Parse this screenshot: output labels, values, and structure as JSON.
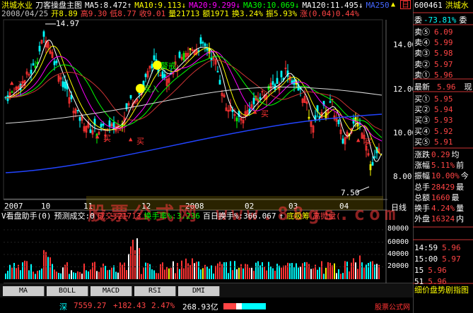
{
  "header1": [
    {
      "text": "洪城水业",
      "color": "#ffff00"
    },
    {
      "text": "刀客操盘主图",
      "color": "#ffffff"
    },
    {
      "text": "MA5:8.472↑",
      "color": "#ffffff"
    },
    {
      "text": "MA10:9.113↓",
      "color": "#ffff00"
    },
    {
      "text": "MA20:9.299↓",
      "color": "#ff00ff"
    },
    {
      "text": "MA30:10.069↓",
      "color": "#00ff00"
    },
    {
      "text": "MA120:11.495↓",
      "color": "#ffffff"
    },
    {
      "text": "MA250",
      "color": "#4466ff"
    }
  ],
  "header2": [
    {
      "text": "2008/04/25",
      "color": "#c0c0c0"
    },
    {
      "text": "开8.89",
      "color": "#ffff00"
    },
    {
      "text": "高9.30",
      "color": "#ff4444"
    },
    {
      "text": "低8.77",
      "color": "#ff4444"
    },
    {
      "text": "收9.01",
      "color": "#ff4444"
    },
    {
      "text": "量21713",
      "color": "#ffff00"
    },
    {
      "text": "额1971",
      "color": "#ffff00"
    },
    {
      "text": "换3.24%",
      "color": "#ffff00"
    },
    {
      "text": "振5.93%",
      "color": "#ffff00"
    },
    {
      "text": "涨(0.04)0.44%",
      "color": "#ff4444"
    }
  ],
  "right_top_icons": {
    "a": "▲",
    "b": "日"
  },
  "price_axis": [
    "14.00",
    "12.00",
    "10.00",
    "8.00"
  ],
  "price_annotations": {
    "high": "14.97",
    "low": "7.50"
  },
  "signals": [
    {
      "text": "买"
    },
    {
      "text": "买"
    },
    {
      "text": "买"
    },
    {
      "text": "买"
    },
    {
      "text": "买"
    }
  ],
  "markers": [
    {
      "text": "警戒"
    },
    {
      "text": "买入"
    }
  ],
  "date_axis": [
    "2007",
    "10",
    "11",
    "12",
    "2008",
    "02",
    "03",
    "04"
  ],
  "period_label": "日线",
  "indicator_header": [
    {
      "text": "V看盘助手(0)",
      "color": "#ffffff"
    },
    {
      "text": "预测成交:0",
      "color": "#ffffff"
    },
    {
      "text": "成交:21713",
      "color": "#ff4444"
    },
    {
      "text": "换手率%:3.236",
      "color": "#00ff00"
    },
    {
      "text": "百日换手%:366.067",
      "color": "#ffffff"
    },
    {
      "text": "↑",
      "color": "#ffffff"
    },
    {
      "text": "底吸筹",
      "color": "#ffff00"
    },
    {
      "text": "高抛盘(",
      "color": "#ff4444"
    }
  ],
  "volume_axis": [
    "80000",
    "60000",
    "40000",
    "20000"
  ],
  "watermark": "股票公式网 www.88gs.com",
  "tabs": [
    "MA",
    "BOLL",
    "MACD",
    "RSI",
    "DMI"
  ],
  "status": {
    "name": "深",
    "index": "7559.27",
    "change": "+182.43",
    "percent": "2.47%",
    "amount": "268.93亿",
    "watermark": "股票公式网 www.88gs.com"
  },
  "right_panel": {
    "code": "600461",
    "name": "洪城水",
    "weibi_label": "委",
    "weibi_value": "-73.81%",
    "weibi_cut": "委",
    "sells": [
      {
        "label": "卖⑤",
        "price": "6.09"
      },
      {
        "label": "卖④",
        "price": "5.99"
      },
      {
        "label": "卖③",
        "price": "5.98"
      },
      {
        "label": "卖②",
        "price": "5.97"
      },
      {
        "label": "卖①",
        "price": "5.96"
      }
    ],
    "latest_label": "最新",
    "latest_value": "5.96",
    "latest_cut": "现",
    "buys": [
      {
        "label": "买①",
        "price": "5.95"
      },
      {
        "label": "买②",
        "price": "5.94"
      },
      {
        "label": "买③",
        "price": "5.93"
      },
      {
        "label": "买④",
        "price": "5.92"
      },
      {
        "label": "买⑤",
        "price": "5.91"
      }
    ],
    "stats": [
      {
        "label": "涨跌",
        "value": "0.29",
        "cut": "均"
      },
      {
        "label": "涨幅",
        "value": "5.11%",
        "cut": "前"
      },
      {
        "label": "振幅",
        "value": "10.00%",
        "cut": "今"
      },
      {
        "label": "总手",
        "value": "28429",
        "cut": "最"
      },
      {
        "label": "总额",
        "value": "1660",
        "cut": "最"
      },
      {
        "label": "换手",
        "value": "4.24%",
        "cut": "量"
      },
      {
        "label": "外盘",
        "value": "16324",
        "cut": "内"
      }
    ],
    "ticks": [
      {
        "time": "14:59",
        "price": "5.96"
      },
      {
        "time": "15:00",
        "price": "5.97"
      },
      {
        "time": "15",
        "price": "5.96"
      },
      {
        "time": "51",
        "price": "5.96"
      }
    ],
    "footer": "细价盘势剧指图"
  },
  "colors": {
    "up": "#ff3333",
    "down": "#00ffff",
    "yellow": "#ffff00",
    "green": "#00ff00"
  }
}
